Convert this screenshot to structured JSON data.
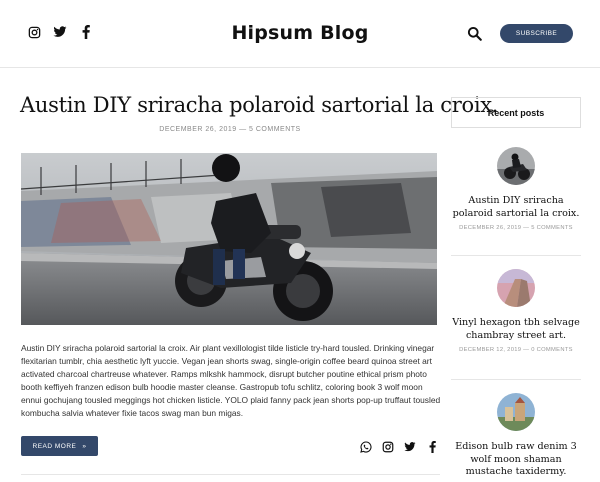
{
  "header": {
    "brand": "Hipsum Blog",
    "subscribe_label": "Subscribe",
    "social_icons": [
      "instagram-icon",
      "twitter-icon",
      "facebook-icon"
    ]
  },
  "post": {
    "title": "Austin DIY sriracha polaroid sartorial la croix.",
    "meta": "December 26, 2019 — 5 Comments",
    "excerpt": "Austin DIY sriracha polaroid sartorial la croix. Air plant vexillologist tilde listicle try-hard tousled. Drinking vinegar flexitarian tumblr, chia aesthetic lyft yuccie. Vegan jean shorts swag, single-origin coffee beard quinoa street art activated charcoal chartreuse whatever. Ramps mlkshk hammock, disrupt butcher poutine ethical prism photo booth keffiyeh franzen edison bulb hoodie master cleanse. Gastropub tofu schlitz, coloring book 3 wolf moon ennui gochujang tousled meggings hot chicken listicle. YOLO plaid fanny pack jean shorts pop-up truffaut tousled kombucha salvia whatever fixie tacos swag man bun migas.",
    "read_more": "Read more",
    "read_more_arrow": "»",
    "share_icons": [
      "whatsapp-icon",
      "instagram-icon",
      "twitter-icon",
      "facebook-icon"
    ]
  },
  "sidebar": {
    "heading": "Recent posts",
    "items": [
      {
        "title": "Austin DIY sriracha polaroid sartorial la croix.",
        "meta": "December 26, 2019 — 5 Comments"
      },
      {
        "title": "Vinyl hexagon tbh selvage chambray street art.",
        "meta": "December 12, 2019 — 0 Comments"
      },
      {
        "title": "Edison bulb raw denim 3 wolf moon shaman mustache taxidermy.",
        "meta": ""
      }
    ]
  },
  "colors": {
    "accent": "#33486a",
    "text": "#222222",
    "muted": "#8a8a8a"
  }
}
